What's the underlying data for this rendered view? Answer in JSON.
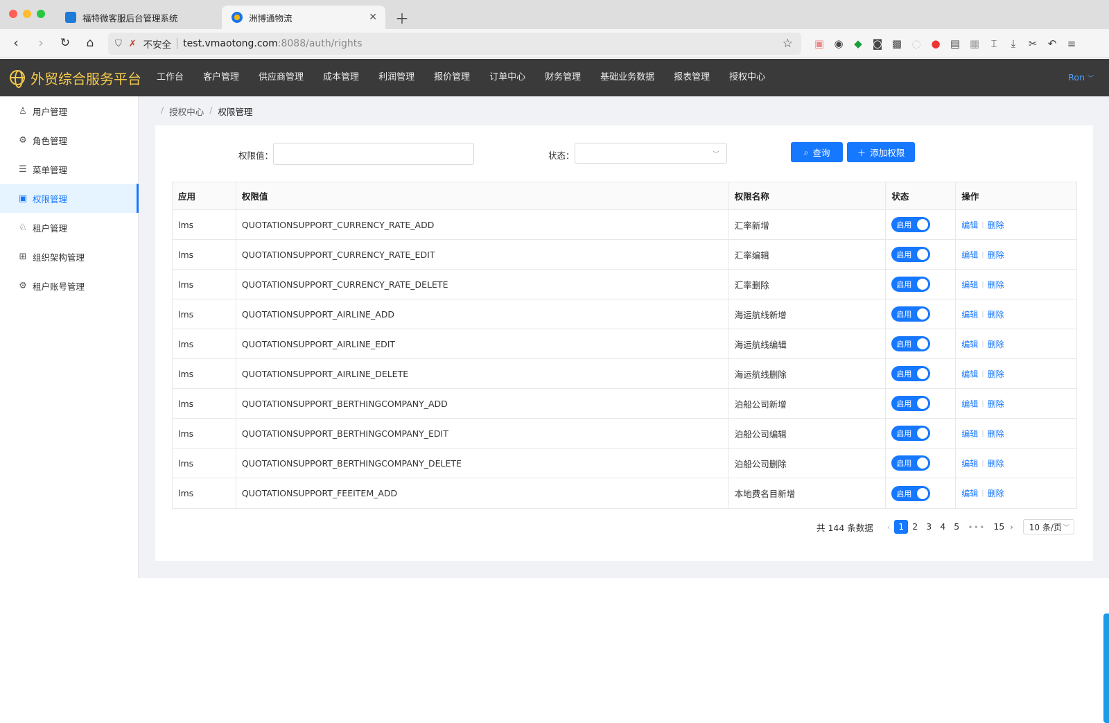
{
  "browser": {
    "tabs": [
      {
        "title": "福特微客服后台管理系统"
      },
      {
        "title": "洲博通物流"
      }
    ],
    "security_label": "不安全",
    "url_host": "test.vmaotong.com",
    "url_rest": ":8088/auth/rights"
  },
  "header": {
    "brand": "外贸综合服务平台",
    "nav": [
      "工作台",
      "客户管理",
      "供应商管理",
      "成本管理",
      "利润管理",
      "报价管理",
      "订单中心",
      "财务管理",
      "基础业务数据",
      "报表管理",
      "授权中心"
    ],
    "user": "Ron"
  },
  "sidebar": {
    "items": [
      {
        "label": "用户管理",
        "icon": "user-icon",
        "glyph": "♙"
      },
      {
        "label": "角色管理",
        "icon": "role-icon",
        "glyph": "⚙"
      },
      {
        "label": "菜单管理",
        "icon": "menu-icon",
        "glyph": "☰"
      },
      {
        "label": "权限管理",
        "icon": "lock-icon",
        "glyph": "🔒"
      },
      {
        "label": "租户管理",
        "icon": "tenant-icon",
        "glyph": "♘"
      },
      {
        "label": "组织架构管理",
        "icon": "org-chart-icon",
        "glyph": "⊞"
      },
      {
        "label": "租户账号管理",
        "icon": "tenant-account-icon",
        "glyph": "⚙"
      }
    ],
    "active_index": 3
  },
  "breadcrumb": {
    "items": [
      "授权中心",
      "权限管理"
    ]
  },
  "filter": {
    "rights_label": "权限值：",
    "rights_value": "",
    "status_label": "状态：",
    "status_value": "",
    "query_button": "查询",
    "add_button": "添加权限"
  },
  "table": {
    "headers": [
      "应用",
      "权限值",
      "权限名称",
      "状态",
      "操作"
    ],
    "rows": [
      {
        "app": "lms",
        "value": "QUOTATIONSUPPORT_CURRENCY_RATE_ADD",
        "name": "汇率新增",
        "status": "启用"
      },
      {
        "app": "lms",
        "value": "QUOTATIONSUPPORT_CURRENCY_RATE_EDIT",
        "name": "汇率编辑",
        "status": "启用"
      },
      {
        "app": "lms",
        "value": "QUOTATIONSUPPORT_CURRENCY_RATE_DELETE",
        "name": "汇率删除",
        "status": "启用"
      },
      {
        "app": "lms",
        "value": "QUOTATIONSUPPORT_AIRLINE_ADD",
        "name": "海运航线新增",
        "status": "启用"
      },
      {
        "app": "lms",
        "value": "QUOTATIONSUPPORT_AIRLINE_EDIT",
        "name": "海运航线编辑",
        "status": "启用"
      },
      {
        "app": "lms",
        "value": "QUOTATIONSUPPORT_AIRLINE_DELETE",
        "name": "海运航线删除",
        "status": "启用"
      },
      {
        "app": "lms",
        "value": "QUOTATIONSUPPORT_BERTHINGCOMPANY_ADD",
        "name": "泊船公司新增",
        "status": "启用"
      },
      {
        "app": "lms",
        "value": "QUOTATIONSUPPORT_BERTHINGCOMPANY_EDIT",
        "name": "泊船公司编辑",
        "status": "启用"
      },
      {
        "app": "lms",
        "value": "QUOTATIONSUPPORT_BERTHINGCOMPANY_DELETE",
        "name": "泊船公司删除",
        "status": "启用"
      },
      {
        "app": "lms",
        "value": "QUOTATIONSUPPORT_FEEITEM_ADD",
        "name": "本地费名目新增",
        "status": "启用"
      }
    ],
    "edit_label": "编辑",
    "delete_label": "删除"
  },
  "pagination": {
    "total_text": "共 144 条数据",
    "pages": [
      "1",
      "2",
      "3",
      "4",
      "5"
    ],
    "current": "1",
    "dots": "•••",
    "last_page": "15",
    "page_size": "10 条/页"
  },
  "colors": {
    "primary": "#1677ff",
    "header_bg": "#3a3a3a",
    "brand": "#f2c94c"
  }
}
